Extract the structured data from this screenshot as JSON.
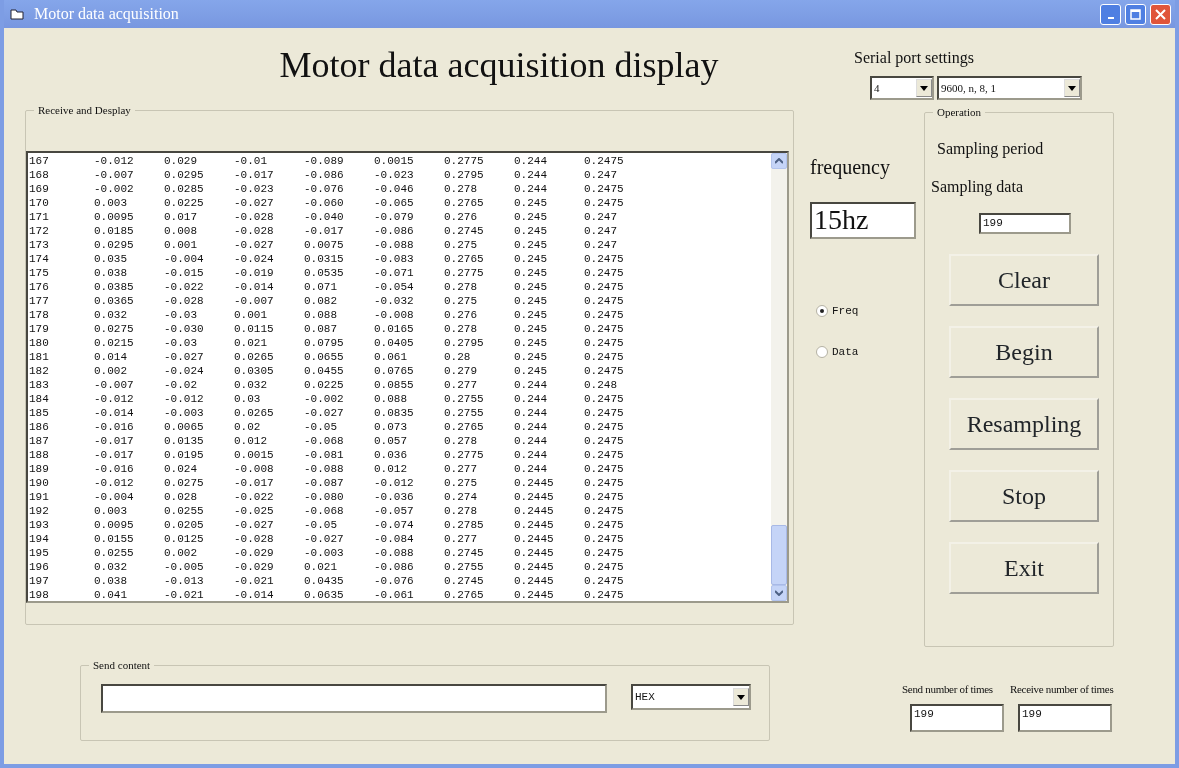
{
  "window": {
    "title": "Motor data acquisition"
  },
  "heading": "Motor data acquisition display",
  "receive": {
    "legend": "Receive and Desplay",
    "rows": [
      [
        "167",
        "-0.012",
        "0.029",
        "-0.01",
        "-0.089",
        "0.0015",
        "0.2775",
        "0.244",
        "0.2475"
      ],
      [
        "168",
        "-0.007",
        "0.0295",
        "-0.017",
        "-0.086",
        "-0.023",
        "0.2795",
        "0.244",
        "0.247"
      ],
      [
        "169",
        "-0.002",
        "0.0285",
        "-0.023",
        "-0.076",
        "-0.046",
        "0.278",
        "0.244",
        "0.2475"
      ],
      [
        "170",
        "0.003",
        "0.0225",
        "-0.027",
        "-0.060",
        "-0.065",
        "0.2765",
        "0.245",
        "0.2475"
      ],
      [
        "171",
        "0.0095",
        "0.017",
        "-0.028",
        "-0.040",
        "-0.079",
        "0.276",
        "0.245",
        "0.247"
      ],
      [
        "172",
        "0.0185",
        "0.008",
        "-0.028",
        "-0.017",
        "-0.086",
        "0.2745",
        "0.245",
        "0.247"
      ],
      [
        "173",
        "0.0295",
        "0.001",
        "-0.027",
        "0.0075",
        "-0.088",
        "0.275",
        "0.245",
        "0.247"
      ],
      [
        "174",
        "0.035",
        "-0.004",
        "-0.024",
        "0.0315",
        "-0.083",
        "0.2765",
        "0.245",
        "0.2475"
      ],
      [
        "175",
        "0.038",
        "-0.015",
        "-0.019",
        "0.0535",
        "-0.071",
        "0.2775",
        "0.245",
        "0.2475"
      ],
      [
        "176",
        "0.0385",
        "-0.022",
        "-0.014",
        "0.071",
        "-0.054",
        "0.278",
        "0.245",
        "0.2475"
      ],
      [
        "177",
        "0.0365",
        "-0.028",
        "-0.007",
        "0.082",
        "-0.032",
        "0.275",
        "0.245",
        "0.2475"
      ],
      [
        "178",
        "0.032",
        "-0.03",
        "0.001",
        "0.088",
        "-0.008",
        "0.276",
        "0.245",
        "0.2475"
      ],
      [
        "179",
        "0.0275",
        "-0.030",
        "0.0115",
        "0.087",
        "0.0165",
        "0.278",
        "0.245",
        "0.2475"
      ],
      [
        "180",
        "0.0215",
        "-0.03",
        "0.021",
        "0.0795",
        "0.0405",
        "0.2795",
        "0.245",
        "0.2475"
      ],
      [
        "181",
        "0.014",
        "-0.027",
        "0.0265",
        "0.0655",
        "0.061",
        "0.28",
        "0.245",
        "0.2475"
      ],
      [
        "182",
        "0.002",
        "-0.024",
        "0.0305",
        "0.0455",
        "0.0765",
        "0.279",
        "0.245",
        "0.2475"
      ],
      [
        "183",
        "-0.007",
        "-0.02",
        "0.032",
        "0.0225",
        "0.0855",
        "0.277",
        "0.244",
        "0.248"
      ],
      [
        "184",
        "-0.012",
        "-0.012",
        "0.03",
        "-0.002",
        "0.088",
        "0.2755",
        "0.244",
        "0.2475"
      ],
      [
        "185",
        "-0.014",
        "-0.003",
        "0.0265",
        "-0.027",
        "0.0835",
        "0.2755",
        "0.244",
        "0.2475"
      ],
      [
        "186",
        "-0.016",
        "0.0065",
        "0.02",
        "-0.05",
        "0.073",
        "0.2765",
        "0.244",
        "0.2475"
      ],
      [
        "187",
        "-0.017",
        "0.0135",
        "0.012",
        "-0.068",
        "0.057",
        "0.278",
        "0.244",
        "0.2475"
      ],
      [
        "188",
        "-0.017",
        "0.0195",
        "0.0015",
        "-0.081",
        "0.036",
        "0.2775",
        "0.244",
        "0.2475"
      ],
      [
        "189",
        "-0.016",
        "0.024",
        "-0.008",
        "-0.088",
        "0.012",
        "0.277",
        "0.244",
        "0.2475"
      ],
      [
        "190",
        "-0.012",
        "0.0275",
        "-0.017",
        "-0.087",
        "-0.012",
        "0.275",
        "0.2445",
        "0.2475"
      ],
      [
        "191",
        "-0.004",
        "0.028",
        "-0.022",
        "-0.080",
        "-0.036",
        "0.274",
        "0.2445",
        "0.2475"
      ],
      [
        "192",
        "0.003",
        "0.0255",
        "-0.025",
        "-0.068",
        "-0.057",
        "0.278",
        "0.2445",
        "0.2475"
      ],
      [
        "193",
        "0.0095",
        "0.0205",
        "-0.027",
        "-0.05",
        "-0.074",
        "0.2785",
        "0.2445",
        "0.2475"
      ],
      [
        "194",
        "0.0155",
        "0.0125",
        "-0.028",
        "-0.027",
        "-0.084",
        "0.277",
        "0.2445",
        "0.2475"
      ],
      [
        "195",
        "0.0255",
        "0.002",
        "-0.029",
        "-0.003",
        "-0.088",
        "0.2745",
        "0.2445",
        "0.2475"
      ],
      [
        "196",
        "0.032",
        "-0.005",
        "-0.029",
        "0.021",
        "-0.086",
        "0.2755",
        "0.2445",
        "0.2475"
      ],
      [
        "197",
        "0.038",
        "-0.013",
        "-0.021",
        "0.0435",
        "-0.076",
        "0.2745",
        "0.2445",
        "0.2475"
      ],
      [
        "198",
        "0.041",
        "-0.021",
        "-0.014",
        "0.0635",
        "-0.061",
        "0.2765",
        "0.2445",
        "0.2475"
      ]
    ]
  },
  "send": {
    "legend": "Send content",
    "format": "HEX"
  },
  "serial": {
    "title": "Serial port settings",
    "port": "4",
    "settings": "9600, n, 8, 1"
  },
  "frequency": {
    "label": "frequency",
    "display": "15hz",
    "options": [
      {
        "label": "Freq",
        "selected": true
      },
      {
        "label": "Data",
        "selected": false
      }
    ]
  },
  "operation": {
    "legend": "Operation",
    "period_label": "Sampling period",
    "data_label": "Sampling data",
    "data_value": "199",
    "buttons": [
      {
        "label": "Clear"
      },
      {
        "label": "Begin"
      },
      {
        "label": "Resampling"
      },
      {
        "label": "Stop"
      },
      {
        "label": "Exit"
      }
    ]
  },
  "counts": [
    {
      "label": "Send number of times",
      "value": "199"
    },
    {
      "label": "Receive number of times",
      "value": "199"
    }
  ]
}
